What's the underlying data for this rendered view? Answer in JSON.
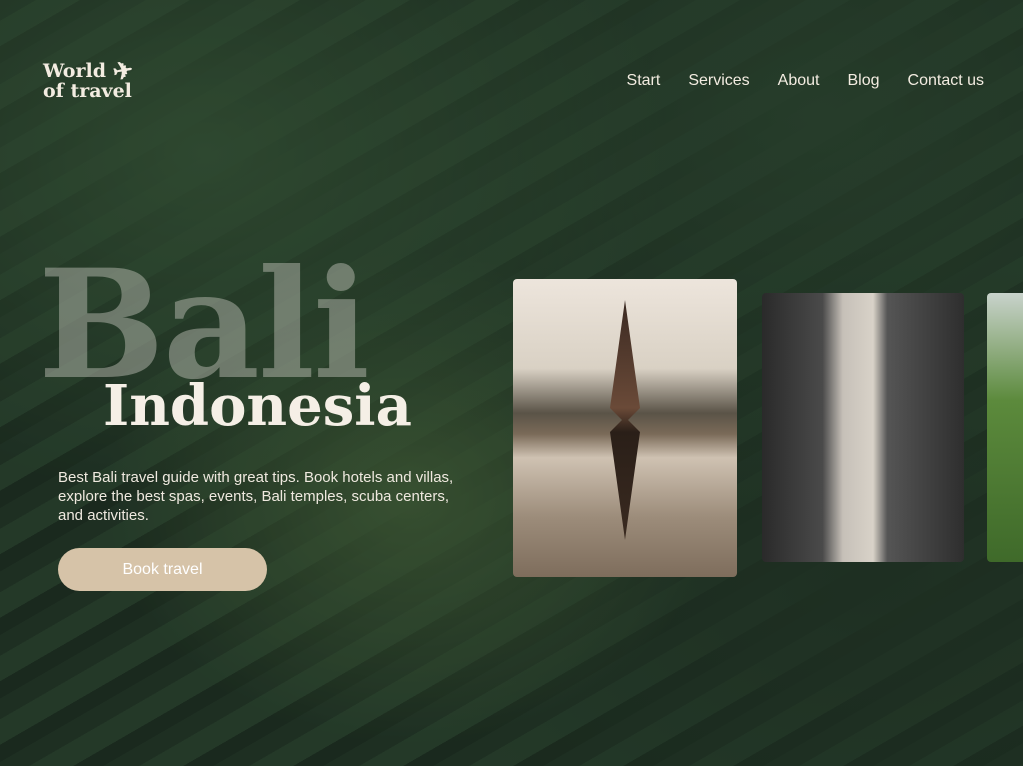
{
  "logo": {
    "line1": "World",
    "line2": "of travel"
  },
  "nav": [
    "Start",
    "Services",
    "About",
    "Blog",
    "Contact us"
  ],
  "hero": {
    "title_bg": "Bali",
    "title": "Indonesia",
    "description": "Best Bali travel guide with great tips. Book hotels and villas, explore the best spas, events, Bali temples, scuba centers, and activities.",
    "button": "Book travel"
  }
}
